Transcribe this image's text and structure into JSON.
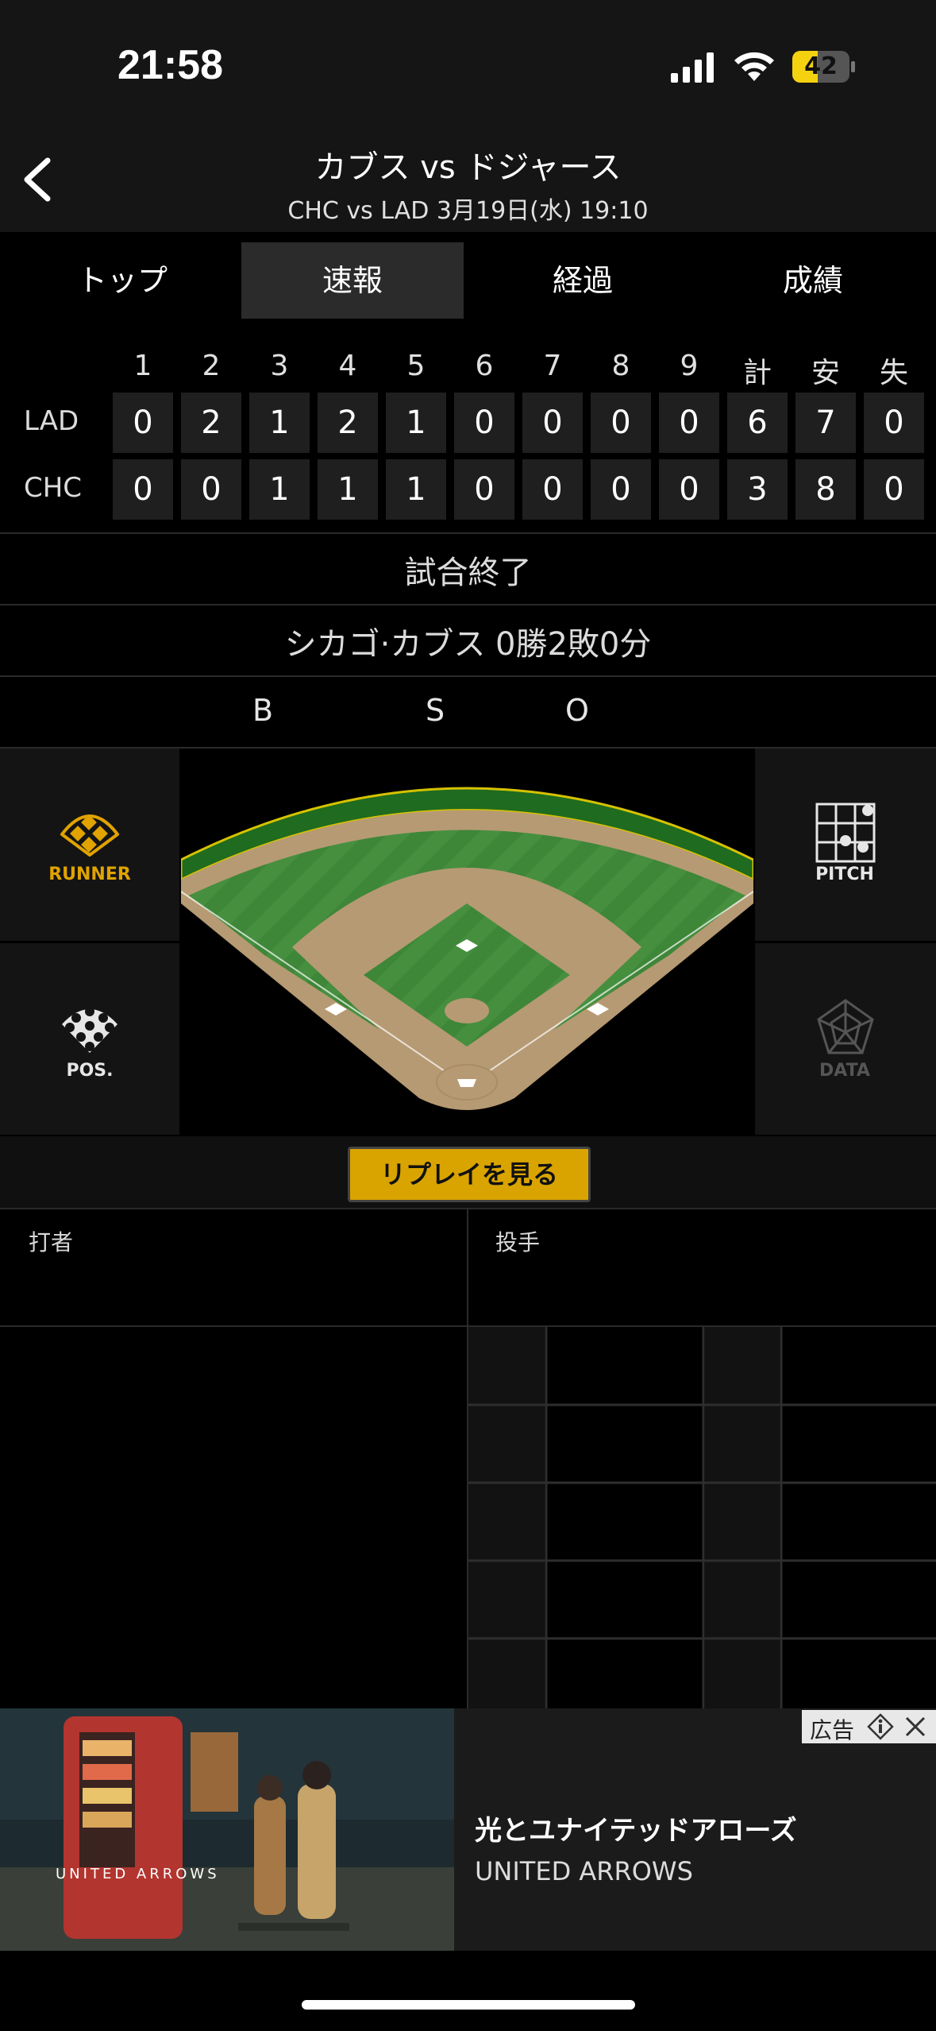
{
  "status_bar": {
    "time": "21:58",
    "battery": "42"
  },
  "header": {
    "title": "カブス vs ドジャース",
    "subtitle": "CHC vs LAD 3月19日(水) 19:10"
  },
  "tabs": [
    {
      "label": "トップ",
      "active": false
    },
    {
      "label": "速報",
      "active": true
    },
    {
      "label": "経過",
      "active": false
    },
    {
      "label": "成績",
      "active": false
    }
  ],
  "scoreboard": {
    "columns": [
      "1",
      "2",
      "3",
      "4",
      "5",
      "6",
      "7",
      "8",
      "9",
      "計",
      "安",
      "失"
    ],
    "rows": [
      {
        "team": "LAD",
        "cells": [
          "0",
          "2",
          "1",
          "2",
          "1",
          "0",
          "0",
          "0",
          "0",
          "6",
          "7",
          "0"
        ]
      },
      {
        "team": "CHC",
        "cells": [
          "0",
          "0",
          "1",
          "1",
          "1",
          "0",
          "0",
          "0",
          "0",
          "3",
          "8",
          "0"
        ]
      }
    ]
  },
  "game_status": "試合終了",
  "record": "シカゴ·カブス 0勝2敗0分",
  "count": {
    "b": "B",
    "s": "S",
    "o": "O"
  },
  "panels": {
    "runner": "RUNNER",
    "position": "POS.",
    "pitch": "PITCH",
    "data": "DATA"
  },
  "replay_label": "リプレイを見る",
  "batter_label": "打者",
  "pitcher_label": "投手",
  "ad": {
    "badge": "広告",
    "title": "光とユナイテッドアローズ",
    "brand": "UNITED ARROWS",
    "image_logo": "UNITED ARROWS"
  },
  "colors": {
    "accent": "#d9a400",
    "runner": "#e0a300",
    "field_grass": "#3f8f3a",
    "field_dirt": "#b69a73"
  }
}
